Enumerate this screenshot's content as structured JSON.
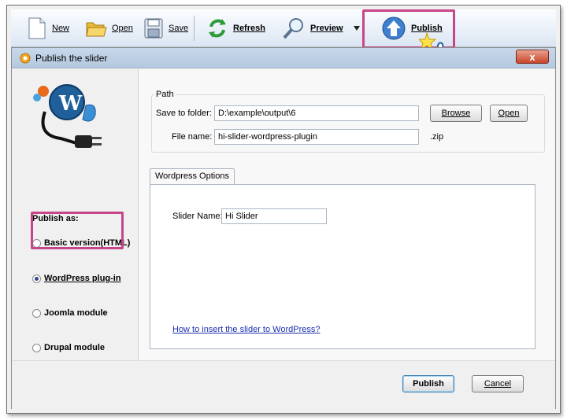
{
  "toolbar": {
    "new_label": "New",
    "open_label": "Open",
    "save_label": "Save",
    "refresh_label": "Refresh",
    "preview_label": "Preview",
    "publish_label": "Publish"
  },
  "dialog": {
    "title": "Publish the slider",
    "close_label": "x",
    "publish_as_label": "Publish as:",
    "options": [
      {
        "label": "Basic version(HTML)",
        "checked": false
      },
      {
        "label": "WordPress plug-in",
        "checked": true
      },
      {
        "label": "Joomla module",
        "checked": false
      },
      {
        "label": "Drupal module",
        "checked": false
      }
    ],
    "path": {
      "group_label": "Path",
      "save_to_label": "Save to folder:",
      "save_to_value": "D:\\example\\output\\6",
      "browse_label": "Browse",
      "open_label": "Open",
      "file_name_label": "File name:",
      "file_name_value": "hi-slider-wordpress-plugin",
      "extension": ".zip"
    },
    "wp": {
      "tab_label": "Wordpress Options",
      "slider_name_label": "Slider Name:",
      "slider_name_value": "Hi Slider",
      "help_link": "How to insert the slider to WordPress?"
    },
    "publish_button": "Publish",
    "cancel_button": "Cancel"
  },
  "colors": {
    "highlight": "#c7468a",
    "link": "#1a2fb0"
  }
}
